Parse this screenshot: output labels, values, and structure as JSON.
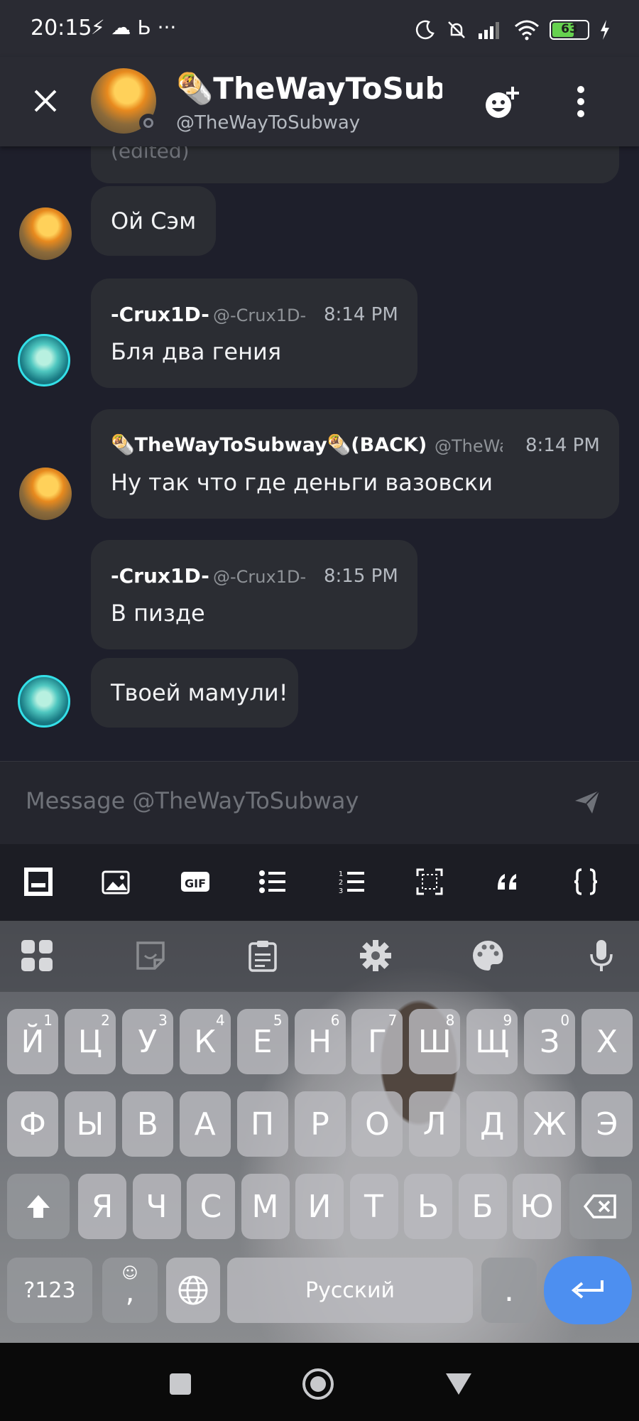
{
  "status_bar": {
    "time": "20:15",
    "left_icons": "⚡ ☁ Ь ···",
    "battery": "63",
    "battery_level": 0.63
  },
  "header": {
    "name": "🌯TheWayToSubway",
    "handle": "@TheWayToSubway"
  },
  "messages": [
    {
      "text": "(edited)"
    },
    {
      "text": "Ой Сэм"
    },
    {
      "author": "-Crux1D-",
      "handle": "@-Crux1D-",
      "time": "8:14 PM",
      "text": "Бля два гения"
    },
    {
      "author": "🌯TheWayToSubway🌯(BACK)",
      "handle": "@TheWa",
      "time": "8:14 PM",
      "text": "Ну так что где деньги вазовски"
    },
    {
      "author": "-Crux1D-",
      "handle": "@-Crux1D-",
      "time": "8:15 PM",
      "text": "В пизде"
    },
    {
      "text": "Твоей мамули!"
    }
  ],
  "composer": {
    "placeholder": "Message @TheWayToSubway"
  },
  "format_toolbar": [
    "keyboard-icon",
    "image-icon",
    "gif-icon",
    "bullet-list-icon",
    "numbered-list-icon",
    "spoiler-icon",
    "quote-icon",
    "code-icon"
  ],
  "keyboard": {
    "toolbar": [
      "apps-grid-icon",
      "sticker-icon",
      "clipboard-icon",
      "settings-icon",
      "palette-icon",
      "mic-icon"
    ],
    "row1": [
      {
        "k": "Й",
        "s": "1"
      },
      {
        "k": "Ц",
        "s": "2"
      },
      {
        "k": "У",
        "s": "3"
      },
      {
        "k": "К",
        "s": "4"
      },
      {
        "k": "Е",
        "s": "5"
      },
      {
        "k": "Н",
        "s": "6"
      },
      {
        "k": "Г",
        "s": "7"
      },
      {
        "k": "Ш",
        "s": "8"
      },
      {
        "k": "Щ",
        "s": "9"
      },
      {
        "k": "З",
        "s": "0"
      },
      {
        "k": "Х",
        "s": ""
      }
    ],
    "row2": [
      "Ф",
      "Ы",
      "В",
      "А",
      "П",
      "Р",
      "О",
      "Л",
      "Д",
      "Ж",
      "Э"
    ],
    "row3": [
      "Я",
      "Ч",
      "С",
      "М",
      "И",
      "Т",
      "Ь",
      "Б",
      "Ю"
    ],
    "symbols_label": "?123",
    "comma_label": ",",
    "space_label": "Русский",
    "period_label": "."
  }
}
